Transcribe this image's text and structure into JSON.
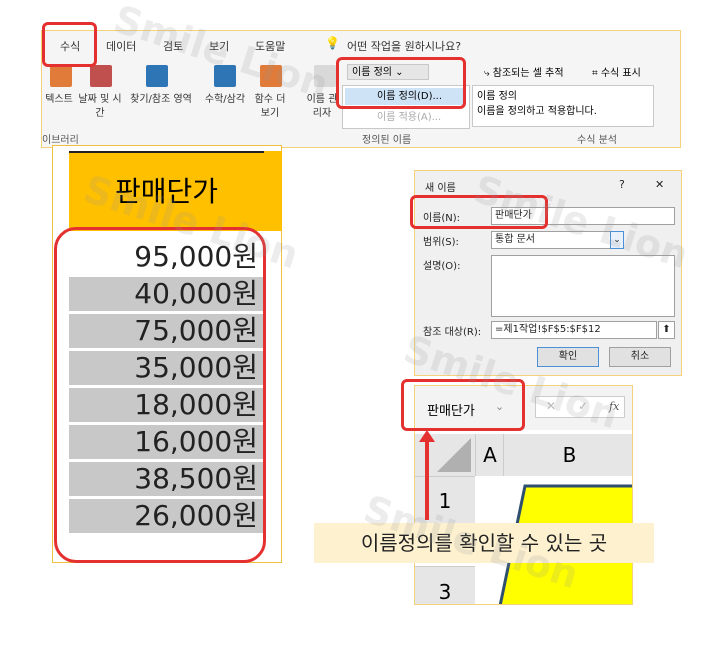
{
  "ribbon": {
    "tabs": [
      "수식",
      "데이터",
      "검토",
      "보기",
      "도움말"
    ],
    "search_prompt": "어떤 작업을 원하시나요?",
    "buttons": {
      "text": "텍스트",
      "date_time": "날짜 및 시간",
      "lookup": "찾기/참조 영역",
      "math": "수학/삼각",
      "more": "함수 더 보기",
      "name_manager": "이름 관리자",
      "define_name": "이름 정의",
      "define_name_menu_item": "이름 정의(D)...",
      "apply_names": "이름 적용(A)...",
      "trace_precedents": "참조되는 셀 추적",
      "show_formulas": "수식 표시"
    },
    "group_labels": {
      "library": "라이브러리",
      "defined_names": "정의된 이름",
      "formula_auditing": "수식 분석"
    },
    "tooltip": {
      "title": "이름 정의",
      "body": "이름을 정의하고 적용합니다."
    },
    "partial_left": "이브러리"
  },
  "table": {
    "header": "판매단가",
    "values": [
      "95,000원",
      "40,000원",
      "75,000원",
      "35,000원",
      "18,000원",
      "16,000원",
      "38,500원",
      "26,000원"
    ]
  },
  "dialog": {
    "title": "새 이름",
    "help": "?",
    "close": "✕",
    "name_label": "이름(N):",
    "name_value": "판매단가",
    "scope_label": "범위(S):",
    "scope_value": "통합 문서",
    "comment_label": "설명(O):",
    "refers_label": "참조 대상(R):",
    "refers_value": "=제1작업!$F$5:$F$12",
    "ok": "확인",
    "cancel": "취소"
  },
  "sheet": {
    "name_box": "판매단가",
    "fx": "fx",
    "col_a": "A",
    "col_b": "B",
    "row_1": "1",
    "row_3": "3"
  },
  "callout": "이름정의를 확인할 수 있는 곳",
  "watermark": "Smile Lion",
  "colors": {
    "highlight_red": "#e53030",
    "header_fill": "#ffc000",
    "callout_bg": "#fdf1d0",
    "shape_yellow": "#ffff00"
  }
}
